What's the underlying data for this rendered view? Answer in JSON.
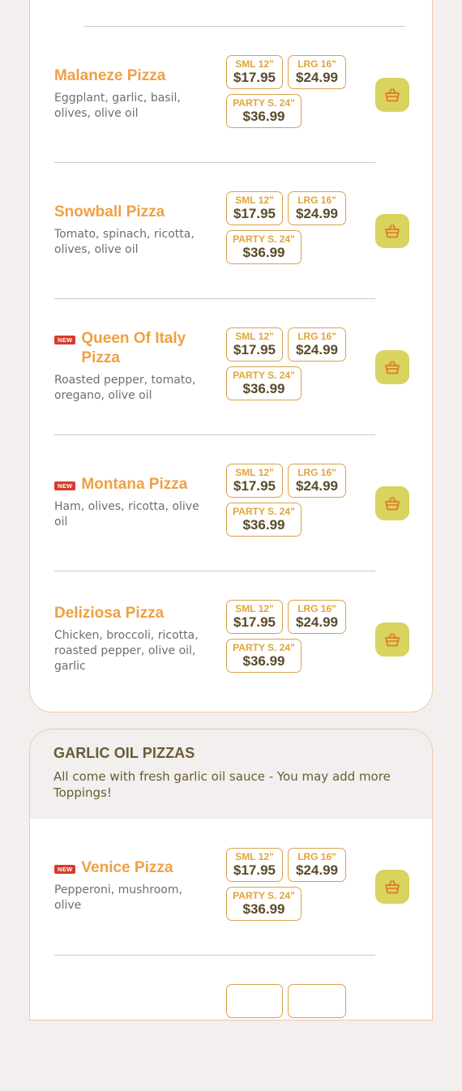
{
  "colors": {
    "accent": "#f0a042",
    "cart": "#d9d35f",
    "badge": "#d93a2b",
    "price_border": "#d9a24a"
  },
  "icons": {
    "cart": "basket-icon"
  },
  "pizza_section": {
    "items": [
      {
        "name": "Malaneze Pizza",
        "new": false,
        "desc": "Eggplant, garlic, basil, olives, olive oil",
        "sml_label": "SML 12\"",
        "sml_price": "$17.95",
        "lrg_label": "LRG 16\"",
        "lrg_price": "$24.99",
        "party_label": "PARTY S. 24\"",
        "party_price": "$36.99"
      },
      {
        "name": "Snowball Pizza",
        "new": false,
        "desc": "Tomato, spinach, ricotta, olives, olive oil",
        "sml_label": "SML 12\"",
        "sml_price": "$17.95",
        "lrg_label": "LRG 16\"",
        "lrg_price": "$24.99",
        "party_label": "PARTY S. 24\"",
        "party_price": "$36.99"
      },
      {
        "name": "Queen Of Italy Pizza",
        "new": true,
        "new_label": "NEW",
        "desc": "Roasted pepper, tomato, oregano, olive oil",
        "sml_label": "SML 12\"",
        "sml_price": "$17.95",
        "lrg_label": "LRG 16\"",
        "lrg_price": "$24.99",
        "party_label": "PARTY S. 24\"",
        "party_price": "$36.99"
      },
      {
        "name": "Montana Pizza",
        "new": true,
        "new_label": "NEW",
        "desc": "Ham, olives, ricotta, olive oil",
        "sml_label": "SML 12\"",
        "sml_price": "$17.95",
        "lrg_label": "LRG 16\"",
        "lrg_price": "$24.99",
        "party_label": "PARTY S. 24\"",
        "party_price": "$36.99"
      },
      {
        "name": "Deliziosa Pizza",
        "new": false,
        "desc": "Chicken, broccoli, ricotta, roasted pepper, olive oil, garlic",
        "sml_label": "SML 12\"",
        "sml_price": "$17.95",
        "lrg_label": "LRG 16\"",
        "lrg_price": "$24.99",
        "party_label": "PARTY S. 24\"",
        "party_price": "$36.99"
      }
    ]
  },
  "garlic_section": {
    "title": "GARLIC OIL PIZZAS",
    "desc": "All come with fresh garlic oil sauce - You may add more Toppings!",
    "items": [
      {
        "name": "Venice Pizza",
        "new": true,
        "new_label": "NEW",
        "desc": "Pepperoni, mushroom, olive",
        "sml_label": "SML 12\"",
        "sml_price": "$17.95",
        "lrg_label": "LRG 16\"",
        "lrg_price": "$24.99",
        "party_label": "PARTY S. 24\"",
        "party_price": "$36.99"
      }
    ]
  }
}
